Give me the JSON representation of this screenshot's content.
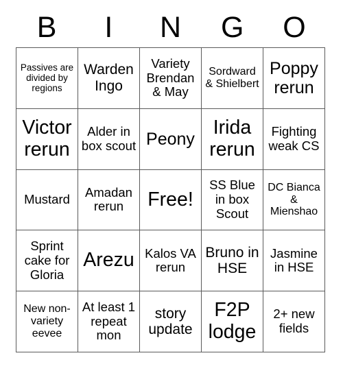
{
  "card": {
    "title": "BINGO",
    "header_letters": [
      "B",
      "I",
      "N",
      "G",
      "O"
    ],
    "columns": 5,
    "rows": 5,
    "free_space_label": "Free!",
    "free_space_index": 12,
    "colors": {
      "background": "#ffffff",
      "cell_background": "#ffffff",
      "border": "#5a5a5a",
      "text": "#000000"
    },
    "cells": [
      {
        "text": "Passives are divided by regions",
        "size": "fs-xs"
      },
      {
        "text": "Warden Ingo",
        "size": "fs-l"
      },
      {
        "text": "Variety Brendan & May",
        "size": "fs-m"
      },
      {
        "text": "Sordward & Shielbert",
        "size": "fs-s"
      },
      {
        "text": "Poppy rerun",
        "size": "fs-xl"
      },
      {
        "text": "Victor rerun",
        "size": "fs-xxl"
      },
      {
        "text": "Alder in box scout",
        "size": "fs-m"
      },
      {
        "text": "Peony",
        "size": "fs-xl"
      },
      {
        "text": "Irida rerun",
        "size": "fs-xxl"
      },
      {
        "text": "Fighting weak CS",
        "size": "fs-m"
      },
      {
        "text": "Mustard",
        "size": "fs-m"
      },
      {
        "text": "Amadan rerun",
        "size": "fs-m"
      },
      {
        "text": "Free!",
        "size": "fs-xxl"
      },
      {
        "text": "SS Blue in box Scout",
        "size": "fs-m"
      },
      {
        "text": "DC Bianca & Mienshao",
        "size": "fs-s"
      },
      {
        "text": "Sprint cake for Gloria",
        "size": "fs-m"
      },
      {
        "text": "Arezu",
        "size": "fs-xxl"
      },
      {
        "text": "Kalos VA rerun",
        "size": "fs-m"
      },
      {
        "text": "Bruno in HSE",
        "size": "fs-l"
      },
      {
        "text": "Jasmine in HSE",
        "size": "fs-m"
      },
      {
        "text": "New non-variety eevee",
        "size": "fs-s"
      },
      {
        "text": "At least 1 repeat mon",
        "size": "fs-m"
      },
      {
        "text": "story update",
        "size": "fs-l"
      },
      {
        "text": "F2P lodge",
        "size": "fs-xxl"
      },
      {
        "text": "2+ new fields",
        "size": "fs-m"
      }
    ]
  }
}
